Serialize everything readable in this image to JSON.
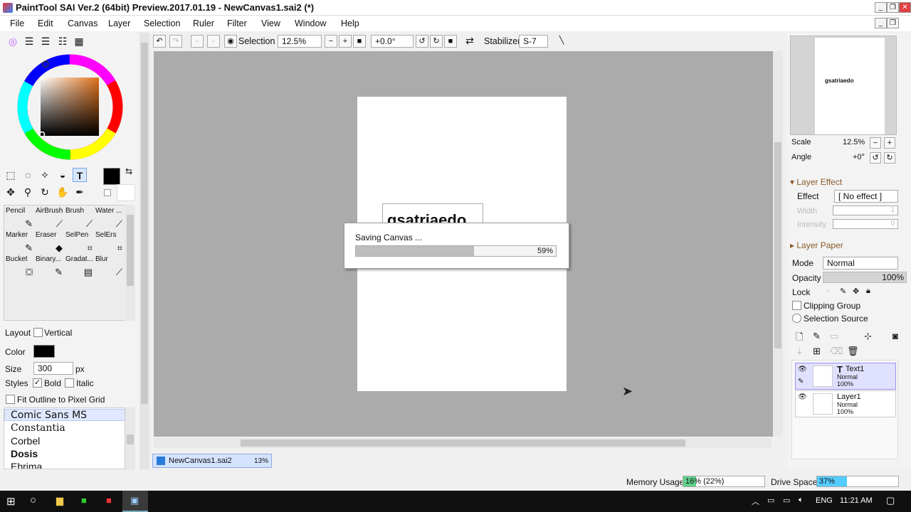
{
  "window": {
    "title": "PaintTool SAI Ver.2 (64bit) Preview.2017.01.19 - NewCanvas1.sai2 (*)"
  },
  "menu": [
    "File",
    "Edit",
    "Canvas",
    "Layer",
    "Selection",
    "Ruler",
    "Filter",
    "View",
    "Window",
    "Help"
  ],
  "toolbar": {
    "selection_label": "Selection",
    "zoom": "12.5%",
    "rotation": "+0.0°",
    "stabilizer_label": "Stabilizer",
    "stabilizer_value": "S-7"
  },
  "brushes": [
    {
      "label": "Pencil",
      "icon": "pencil-icon"
    },
    {
      "label": "AirBrush",
      "icon": "airbrush-icon"
    },
    {
      "label": "Brush",
      "icon": "brush-icon"
    },
    {
      "label": "Water ...",
      "icon": "water-icon"
    },
    {
      "label": "Marker",
      "icon": "marker-icon"
    },
    {
      "label": "Eraser",
      "icon": "eraser-icon"
    },
    {
      "label": "SelPen",
      "icon": "selpen-icon"
    },
    {
      "label": "SelErs",
      "icon": "selers-icon"
    },
    {
      "label": "Bucket",
      "icon": "bucket-icon"
    },
    {
      "label": "Binary...",
      "icon": "binary-icon"
    },
    {
      "label": "Gradat...",
      "icon": "gradient-icon"
    },
    {
      "label": "Blur",
      "icon": "blur-icon"
    }
  ],
  "text_tool": {
    "layout_label": "Layout",
    "vertical_label": "Vertical",
    "color_label": "Color",
    "size_label": "Size",
    "size_value": "300",
    "size_unit": "px",
    "styles_label": "Styles",
    "bold_label": "Bold",
    "italic_label": "Italic",
    "fit_outline_label": "Fit Outline to Pixel Grid",
    "fonts": [
      "Comic Sans MS",
      "Constantia",
      "Corbel",
      "Dosis",
      "Ebrima"
    ]
  },
  "canvas": {
    "preview_text": "gsatriaedo",
    "tab_label": "NewCanvas1.sai2",
    "tab_zoom": "13%"
  },
  "dialog": {
    "message": "Saving Canvas ...",
    "progress_label": "59%",
    "progress": 0.59
  },
  "navigator": {
    "scale_label": "Scale",
    "scale_value": "12.5%",
    "angle_label": "Angle",
    "angle_value": "+0°",
    "thumb_text": "gsatriaedo"
  },
  "layer_effect": {
    "header": "Layer Effect",
    "effect_label": "Effect",
    "effect_value": "[ No effect ]",
    "width_label": "Width",
    "width_value": "1",
    "intensity_label": "Intensity",
    "intensity_value": "0"
  },
  "layer_paper": {
    "header": "Layer Paper"
  },
  "layer_props": {
    "mode_label": "Mode",
    "mode_value": "Normal",
    "opacity_label": "Opacity",
    "opacity_value": "100%",
    "lock_label": "Lock",
    "clipping_label": "Clipping Group",
    "selection_source_label": "Selection Source"
  },
  "layers": [
    {
      "name": "Text1",
      "mode": "Normal",
      "opacity": "100%",
      "selected": true
    },
    {
      "name": "Layer1",
      "mode": "Normal",
      "opacity": "100%",
      "selected": false
    }
  ],
  "status": {
    "memory_label": "Memory Usage",
    "memory_value": "16% (22%)",
    "memory_fraction": 0.16,
    "drive_label": "Drive Space",
    "drive_value": "37%",
    "drive_fraction": 0.37
  },
  "taskbar": {
    "language": "ENG",
    "time": "11:21 AM"
  },
  "colors": {
    "accent": "#3399ff",
    "memory_fill": "#5fd08a",
    "drive_fill": "#55ccff",
    "canvas_bg": "#ababab"
  }
}
